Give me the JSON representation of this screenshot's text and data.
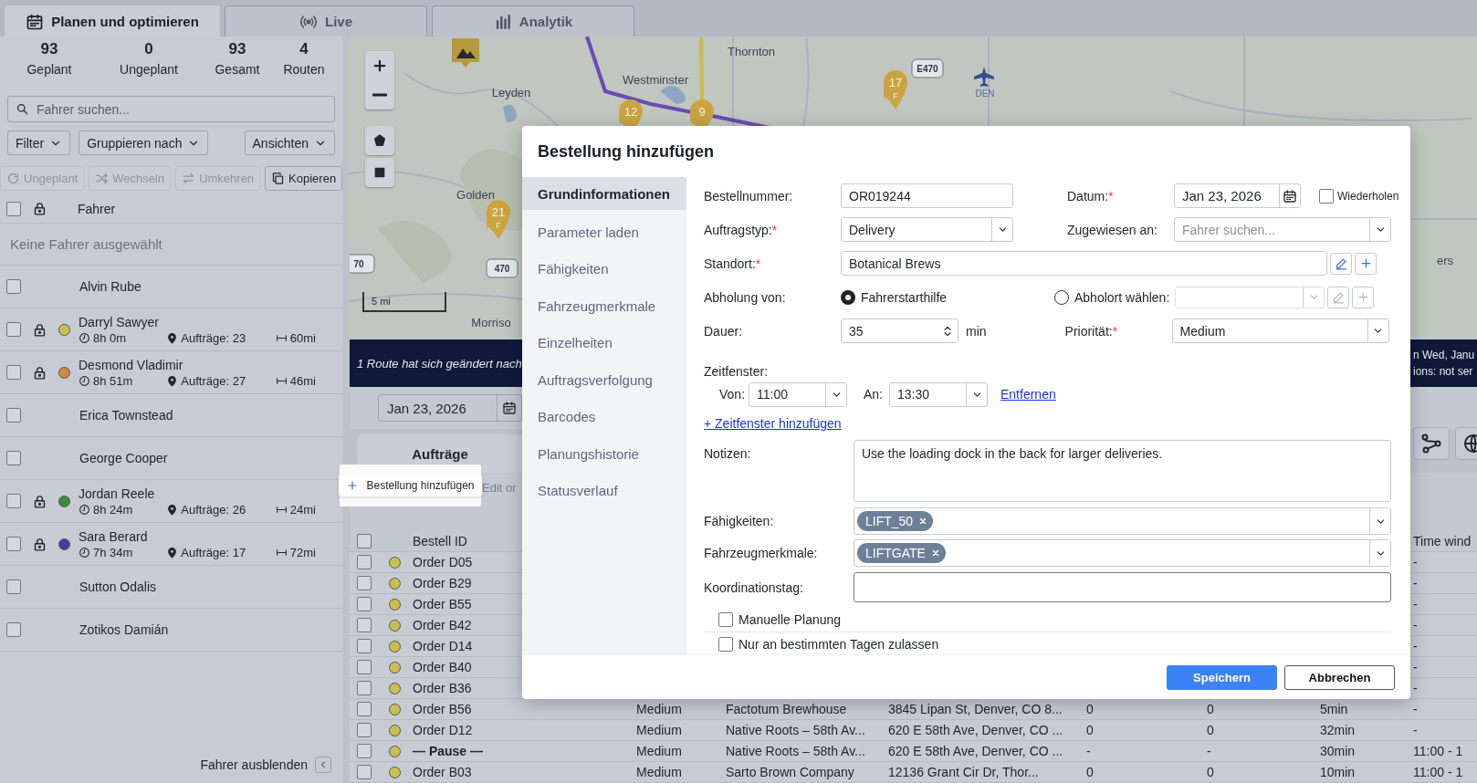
{
  "tabs": [
    {
      "label": "Planen und optimieren",
      "selected": true
    },
    {
      "label": "Live",
      "selected": false
    },
    {
      "label": "Analytik",
      "selected": false
    }
  ],
  "summary": [
    {
      "value": "93",
      "label": "Geplant"
    },
    {
      "value": "0",
      "label": "Ungeplant"
    },
    {
      "value": "93",
      "label": "Gesamt"
    },
    {
      "value": "4",
      "label": "Routen"
    }
  ],
  "driver_search": {
    "placeholder": "Fahrer suchen..."
  },
  "dropdowns": [
    "Filter",
    "Gruppieren nach",
    "Ansichten"
  ],
  "actions": [
    {
      "label": "Ungeplant",
      "disabled": true
    },
    {
      "label": "Wechseln",
      "disabled": true
    },
    {
      "label": "Umkehren",
      "disabled": true
    },
    {
      "label": "Kopieren",
      "disabled": false
    }
  ],
  "drivers_header": {
    "label": "Fahrer",
    "checked": false
  },
  "no_selection": "Keine Fahrer ausgewählt",
  "drivers": [
    {
      "kind": "idle",
      "name": "Alvin Rube",
      "checked": false
    },
    {
      "kind": "route",
      "name": "Darryl Sawyer",
      "checked": false,
      "color": "#c8bf50",
      "time": "8h 0m",
      "orders": "Aufträge: 23",
      "distance": "60mi"
    },
    {
      "kind": "route",
      "name": "Desmond Vladimir",
      "checked": false,
      "color": "#d08a3c",
      "time": "8h 51m",
      "orders": "Aufträge: 27",
      "distance": "46mi"
    },
    {
      "kind": "idle",
      "name": "Erica Townstead",
      "checked": false
    },
    {
      "kind": "idle",
      "name": "George Cooper",
      "checked": false
    },
    {
      "kind": "route",
      "name": "Jordan Reele",
      "checked": false,
      "color": "#3e8a3e",
      "time": "8h 24m",
      "orders": "Aufträge: 26",
      "distance": "24mi"
    },
    {
      "kind": "route",
      "name": "Sara Berard",
      "checked": false,
      "color": "#4a3aa8",
      "time": "7h 34m",
      "orders": "Aufträge: 17",
      "distance": "72mi"
    },
    {
      "kind": "idle",
      "name": "Sutton Odalis",
      "checked": false
    },
    {
      "kind": "idle",
      "name": "Zotikos Damián",
      "checked": false
    }
  ],
  "hide_drivers": "Fahrer ausblenden",
  "map": {
    "places": [
      "Thornton",
      "Leyden",
      "Westminster",
      "Golden",
      "Morriso",
      "ers"
    ],
    "highways": [
      "E470",
      "70",
      "470"
    ],
    "airport": "DEN",
    "pins": [
      {
        "label": "12"
      },
      {
        "label": "9"
      },
      {
        "label": "17",
        "sub": "F"
      },
      {
        "label": "21",
        "sub": "F"
      }
    ],
    "scale": "5 mi"
  },
  "banner": {
    "text": "1 Route hat sich geändert nach",
    "right_lines": [
      "n Wed, Janu",
      "ions: not ser"
    ]
  },
  "orders_date": "Jan 23, 2026",
  "orders_tab": "Aufträge",
  "add_order_button": "Bestellung hinzufügen",
  "edit_order": "Edit or",
  "orders": {
    "checked": false,
    "id_label": "Bestell ID",
    "time_window_label": "Time wind",
    "rows": [
      {
        "kind": "order",
        "id": "Order D05",
        "checked": false,
        "color": "#c8bf50",
        "time_window": "-"
      },
      {
        "kind": "order",
        "id": "Order B29",
        "checked": false,
        "color": "#c8bf50",
        "time_window": "-"
      },
      {
        "kind": "order",
        "id": "Order B55",
        "checked": false,
        "color": "#c8bf50",
        "time_window": "-"
      },
      {
        "kind": "order",
        "id": "Order B42",
        "checked": false,
        "color": "#c8bf50",
        "time_window": "-"
      },
      {
        "kind": "order",
        "id": "Order D14",
        "checked": false,
        "color": "#c8bf50",
        "time_window": "-"
      },
      {
        "kind": "order",
        "id": "Order B40",
        "checked": false,
        "color": "#c8bf50",
        "time_window": "-"
      },
      {
        "kind": "order",
        "id": "Order B36",
        "checked": false,
        "color": "#c8bf50",
        "time_window": "-"
      },
      {
        "kind": "order",
        "id": "Order B56",
        "checked": false,
        "color": "#c8bf50",
        "priority": "Medium",
        "name": "Factotum Brewhouse",
        "address": "3845 Lipan St, Denver, CO 8...",
        "col_a": "0",
        "col_b": "0",
        "duration": "5min",
        "time_window": "-"
      },
      {
        "kind": "order",
        "id": "Order D12",
        "checked": false,
        "color": "#c8bf50",
        "priority": "Medium",
        "name": "Native Roots – 58th Av...",
        "address": "620 E 58th Ave, Denver, CO ...",
        "col_a": "0",
        "col_b": "0",
        "duration": "32min",
        "time_window": "-"
      },
      {
        "kind": "pause",
        "id": "— Pause —",
        "checked": false,
        "color": "#c8bf50",
        "priority": "Medium",
        "name": "Native Roots – 58th Av...",
        "address": "620 E 58th Ave, Denver, CO ...",
        "col_a": "-",
        "col_b": "-",
        "duration": "30min",
        "time_window": "11:00 - 1"
      },
      {
        "kind": "order",
        "id": "Order B03",
        "checked": false,
        "color": "#c8bf50",
        "priority": "Medium",
        "name": "Sarto Brown Company",
        "address": "12136 Grant Cir Dr, Thor...",
        "col_a": "0",
        "col_b": "0",
        "duration": "10min",
        "time_window": "11:00 - 1"
      }
    ]
  },
  "dialog": {
    "title": "Bestellung hinzufügen",
    "nav": [
      {
        "label": "Grundinformationen",
        "selected": true
      },
      {
        "label": "Parameter laden",
        "selected": false
      },
      {
        "label": "Fähigkeiten",
        "selected": false
      },
      {
        "label": "Fahrzeugmerkmale",
        "selected": false
      },
      {
        "label": "Einzelheiten",
        "selected": false
      },
      {
        "label": "Auftragsverfolgung",
        "selected": false
      },
      {
        "label": "Barcodes",
        "selected": false
      },
      {
        "label": "Planungshistorie",
        "selected": false
      },
      {
        "label": "Statusverlauf",
        "selected": false
      }
    ],
    "order_number": {
      "label": "Bestellnummer:",
      "value": "OR019244"
    },
    "date": {
      "label": "Datum:",
      "required": "*",
      "value": "Jan 23, 2026"
    },
    "repeat": {
      "label": "Wiederholen",
      "checked": false
    },
    "order_type": {
      "label": "Auftragstyp:",
      "required": "*",
      "value": "Delivery"
    },
    "assigned_to": {
      "label": "Zugewiesen an:",
      "placeholder": "Fahrer suchen..."
    },
    "location": {
      "label": "Standort:",
      "required": "*",
      "value": "Botanical Brews"
    },
    "pickup": {
      "label": "Abholung von:",
      "options": [
        {
          "label": "Fahrerstarthilfe",
          "selected": true
        },
        {
          "label": "Abholort wählen:",
          "selected": false
        }
      ]
    },
    "pickup_location": {
      "disabled": true
    },
    "duration": {
      "label": "Dauer:",
      "value": "35",
      "unit": "min"
    },
    "priority": {
      "label": "Priorität:",
      "required": "*",
      "value": "Medium"
    },
    "time_window": {
      "label": "Zeitfenster:",
      "from_label": "Von:",
      "from": "11:00",
      "to_label": "An:",
      "to": "13:30",
      "remove": "Entfernen"
    },
    "add_time_window": "+ Zeitfenster hinzufügen",
    "notes": {
      "label": "Notizen:",
      "value": "Use the loading dock in the back for larger deliveries."
    },
    "skills": {
      "label": "Fähigkeiten:",
      "tags": [
        "LIFT_50"
      ]
    },
    "vehicle_features": {
      "label": "Fahrzeugmerkmale:",
      "tags": [
        "LIFTGATE"
      ]
    },
    "coordination_tag": {
      "label": "Koordinationstag:"
    },
    "options": [
      {
        "label": "Manuelle Planung",
        "checked": false
      },
      {
        "label": "Nur an bestimmten Tagen zulassen",
        "checked": false
      }
    ],
    "buttons": [
      {
        "label": "Speichern",
        "kind": "primary"
      },
      {
        "label": "Abbrechen",
        "kind": "secondary"
      }
    ]
  }
}
